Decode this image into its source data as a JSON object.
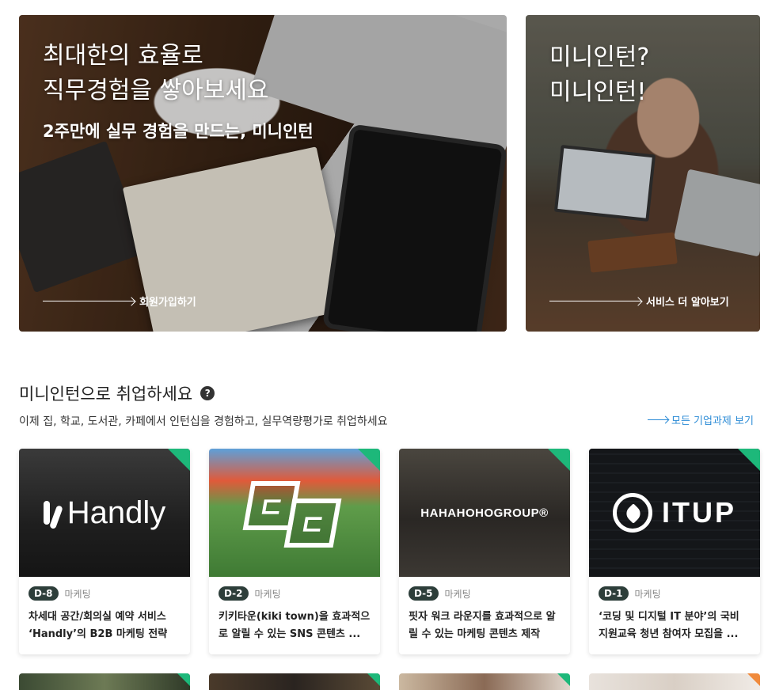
{
  "hero_main": {
    "title_line1": "최대한의 효율로",
    "title_line2": "직무경험을 쌓아보세요",
    "subtitle": "2주만에 실무 경험을 만드는, 미니인턴",
    "link": "회원가입하기"
  },
  "hero_side": {
    "title_line1": "미니인턴?",
    "title_line2": "미니인턴!",
    "link": "서비스 더 알아보기"
  },
  "section": {
    "title": "미니인턴으로 취업하세요",
    "help": "?",
    "description": "이제 집, 학교, 도서관, 카페에서 인턴십을 경험하고, 실무역량평가로 취업하세요",
    "see_all": "모든 기업과제 보기"
  },
  "cards": [
    {
      "logo": "Handly",
      "dday": "D-8",
      "category": "마케팅",
      "title": "차세대 공간/회의실 예약 서비스 ‘Handly’의 B2B 마케팅 전략"
    },
    {
      "logo": "kiki town",
      "dday": "D-2",
      "category": "마케팅",
      "title": "키키타운(kiki town)을 효과적으로 알릴 수 있는 SNS 콘텐츠 ..."
    },
    {
      "logo": "HAHAHOHOGROUP®",
      "dday": "D-5",
      "category": "마케팅",
      "title": "핏자 워크 라운지를 효과적으로 알릴 수 있는 마케팅 콘텐츠 제작"
    },
    {
      "logo": "ITUP",
      "dday": "D-1",
      "category": "마케팅",
      "title": "‘코딩 및 디지털 IT 분야’의 국비 지원교육 청년 참여자 모집을 ..."
    }
  ],
  "colors": {
    "accent": "#2b8bd6",
    "badge": "#2d3e3a",
    "corner": "#1db87a"
  }
}
